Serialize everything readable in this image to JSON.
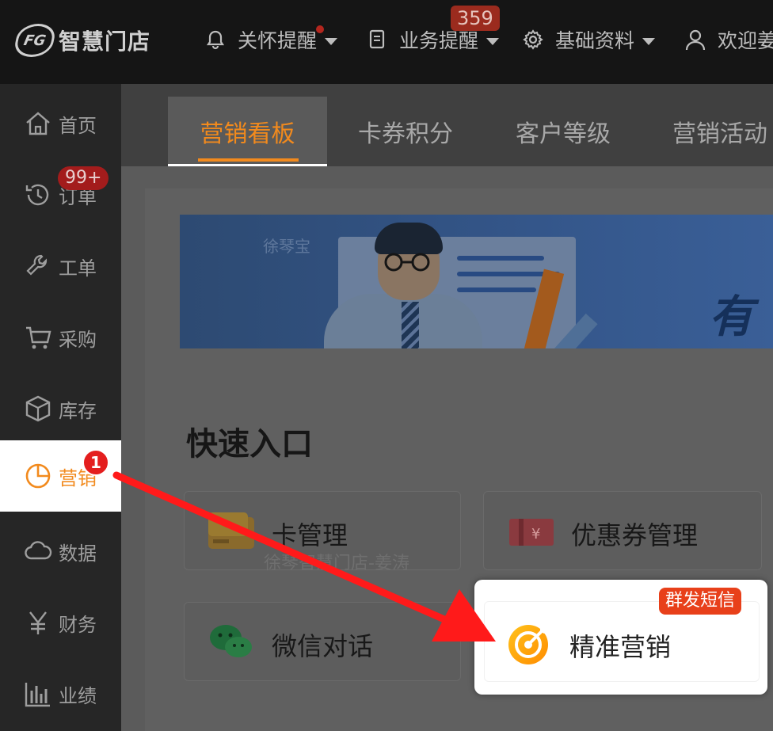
{
  "app": {
    "logo_text": "智慧门店",
    "logo_mark": "FG"
  },
  "topbar": {
    "menus": [
      {
        "label": "关怀提醒",
        "icon": "bell-icon",
        "badge": "dot"
      },
      {
        "label": "业务提醒",
        "icon": "document-icon",
        "badge": "359"
      },
      {
        "label": "基础资料",
        "icon": "gear-icon"
      },
      {
        "label": "欢迎姜",
        "icon": "user-icon"
      }
    ]
  },
  "sidebar": {
    "items": [
      {
        "label": "首页",
        "icon": "home-icon"
      },
      {
        "label": "订单",
        "icon": "history-icon",
        "badge": "99+"
      },
      {
        "label": "工单",
        "icon": "wrench-icon"
      },
      {
        "label": "采购",
        "icon": "cart-icon"
      },
      {
        "label": "库存",
        "icon": "box-icon"
      },
      {
        "label": "营销",
        "icon": "pie-chart-icon",
        "active": true,
        "step": "1"
      },
      {
        "label": "数据",
        "icon": "cloud-icon"
      },
      {
        "label": "财务",
        "icon": "yen-icon"
      },
      {
        "label": "业绩",
        "icon": "bar-chart-icon"
      }
    ]
  },
  "tabs": [
    {
      "label": "营销看板",
      "active": true
    },
    {
      "label": "卡券积分"
    },
    {
      "label": "客户等级"
    },
    {
      "label": "营销活动"
    }
  ],
  "banner": {
    "watermark": "徐琴宝",
    "slogan": "有"
  },
  "quick_entry": {
    "title": "快速入口",
    "cards": [
      {
        "label": "卡管理",
        "icon": "card-icon"
      },
      {
        "label": "优惠券管理",
        "icon": "coupon-icon"
      },
      {
        "label": "微信对话",
        "icon": "wechat-icon"
      },
      {
        "label": "精准营销",
        "icon": "target-icon",
        "tag": "群发短信",
        "highlighted": true
      }
    ],
    "watermark": "徐琴智慧门店-姜涛"
  },
  "colors": {
    "accent": "#f28a1d",
    "badge_red": "#e8401a",
    "arrow": "#ff1a1a",
    "topbar_bg": "#151515",
    "sidebar_bg": "#262626"
  }
}
